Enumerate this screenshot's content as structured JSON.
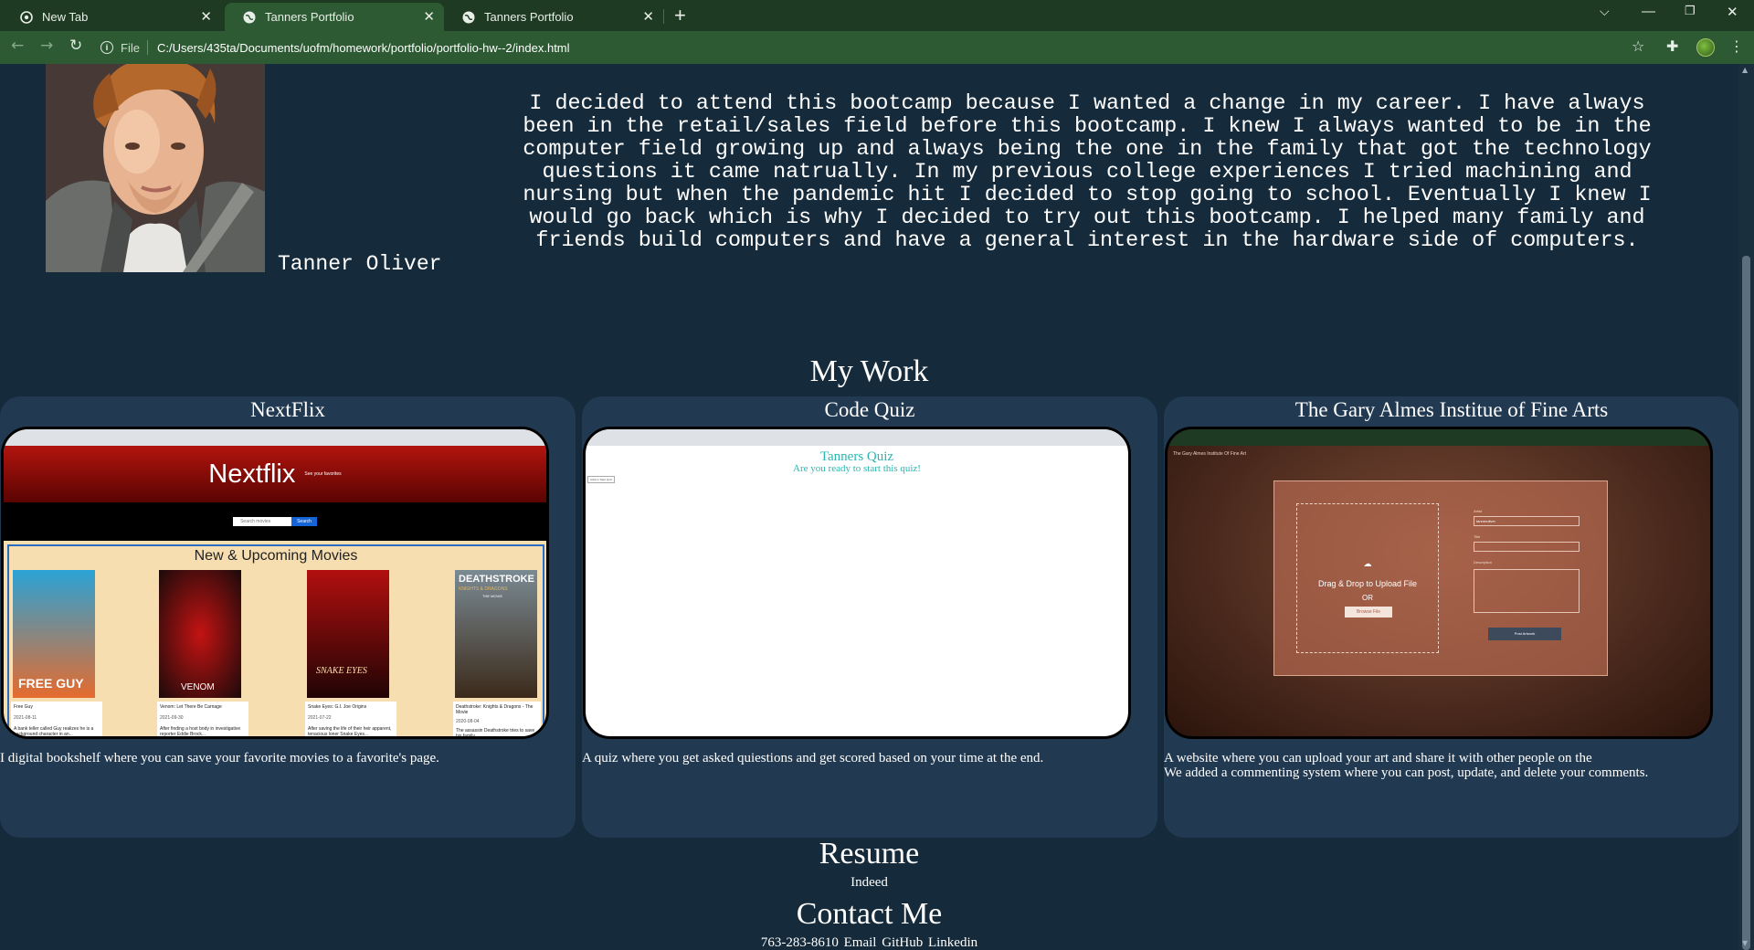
{
  "browser": {
    "tabs": [
      {
        "title": "New Tab",
        "active": false
      },
      {
        "title": "Tanners Portfolio",
        "active": true
      },
      {
        "title": "Tanners Portfolio",
        "active": false
      }
    ],
    "address_scheme": "File",
    "address_url": "C:/Users/435ta/Documents/uofm/homework/portfolio/portfolio-hw--2/index.html",
    "colors": {
      "tabbar": "#1f3a22",
      "toolbar": "#2d5a33"
    }
  },
  "about": {
    "name": "Tanner Oliver",
    "photo_icon": "profile-photo",
    "text": "I decided to attend this bootcamp because I wanted a change in my career. I have always been in the retail/sales field before this bootcamp. I knew I always wanted to be in the computer field growing up and always being the one in the family that got the technology questions it came natrually. In my previous college experiences I tried machining and nursing but when the pandemic hit I decided to stop going to school. Eventually I knew I would go back which is why I decided to try out this bootcamp. I helped many family and friends build computers and have a general interest in the hardware side of computers."
  },
  "my_work": {
    "title": "My Work",
    "projects": [
      {
        "title": "NextFlix",
        "description": "I digital bookshelf where you can save your favorite movies to a favorite's page.",
        "screenshot": {
          "brand": "Nextflix",
          "tagline": "See your favorites",
          "search_placeholder": "Search movies",
          "search_button": "Search",
          "section_heading": "New & Upcoming Movies",
          "movies": [
            {
              "poster_title": "FREE GUY",
              "title": "Free Guy",
              "date": "2021-08-11",
              "blurb": "A bank teller called Guy realizes he is a background character in an..."
            },
            {
              "poster_title": "VENOM",
              "title": "Venom: Let There Be Carnage",
              "date": "2021-09-30",
              "blurb": "After finding a host body in investigative reporter Eddie Brock..."
            },
            {
              "poster_title": "SNAKE EYES",
              "title": "Snake Eyes: G.I. Joe Origins",
              "date": "2021-07-22",
              "blurb": "After saving the life of their heir apparent, tenacious loner Snake Eyes..."
            },
            {
              "poster_title": "DEATHSTROKE",
              "poster_subtitle": "KNIGHTS & DRAGONS",
              "poster_tag": "THE MOVIE",
              "title": "Deathstroke: Knights & Dragons - The Movie",
              "date": "2020-08-04",
              "blurb": "The assassin Deathstroke tries to save his family..."
            }
          ]
        }
      },
      {
        "title": "Code Quiz",
        "description": "A quiz where you get asked quiestions and get scored based on your time at the end.",
        "screenshot": {
          "heading": "Tanners Quiz",
          "subheading": "Are you ready to start this quiz!",
          "button": "Click to Start Quiz"
        }
      },
      {
        "title": "The Gary Almes Institue of Fine Arts",
        "description_line1": "A website where you can upload your art and share it with other people on the",
        "description_line2": "We added a commenting system where you can post, update, and delete your comments.",
        "screenshot": {
          "site_name": "The Gary Almes Institute Of Fine Art",
          "drop_text": "Drag & Drop to Upload File",
          "or_text": "OR",
          "browse_button": "Browse File",
          "artist_label": "Artist",
          "artist_value": "tanneroliver",
          "title_label": "Title",
          "description_label": "Description",
          "post_button": "Post Artwork"
        }
      }
    ]
  },
  "resume": {
    "title": "Resume",
    "link": "Indeed"
  },
  "contact": {
    "title": "Contact Me",
    "phone": "763-283-8610",
    "links": [
      "Email",
      "GitHub",
      "Linkedin"
    ]
  },
  "colors": {
    "page_bg": "#152a3a",
    "card_bg": "#223a51",
    "quiz_accent": "#2bb5b0"
  }
}
